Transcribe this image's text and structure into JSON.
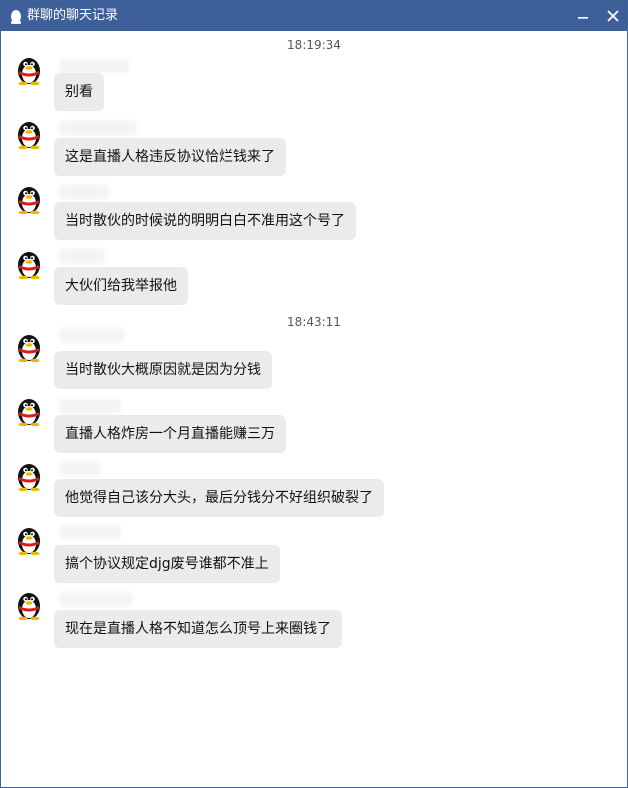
{
  "window": {
    "title": "群聊的聊天记录",
    "title_icon": "qq-penguin-icon",
    "title_bar_color": "#3e6099",
    "minimize_icon": "minimize-icon",
    "close_icon": "close-icon"
  },
  "chat": {
    "timestamps": [
      "18:19:34",
      "18:43:11"
    ],
    "avatar_icon": "qq-penguin-avatar-icon",
    "bubble_color": "#ebebeb",
    "messages": [
      {
        "text": "别看"
      },
      {
        "text": "这是直播人格违反协议恰烂钱来了"
      },
      {
        "text": "当时散伙的时候说的明明白白不准用这个号了"
      },
      {
        "text": "大伙们给我举报他"
      },
      {
        "text": "当时散伙大概原因就是因为分钱"
      },
      {
        "text": "直播人格炸房一个月直播能赚三万"
      },
      {
        "text": "他觉得自己该分大头，最后分钱分不好组织破裂了"
      },
      {
        "text": "搞个协议规定djg废号谁都不准上"
      },
      {
        "text": "现在是直播人格不知道怎么顶号上来圈钱了"
      }
    ]
  }
}
